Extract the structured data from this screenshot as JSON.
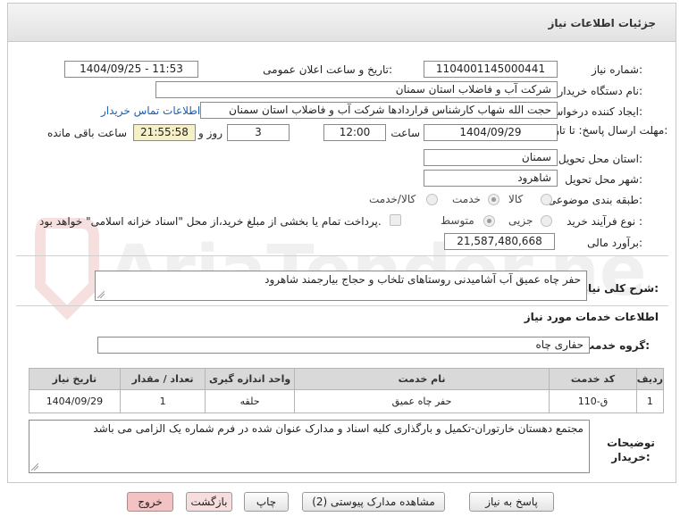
{
  "header": {
    "title": "جزئیات اطلاعات نیاز"
  },
  "fields": {
    "need_number_label": "شماره نیاز:",
    "need_number": "1104001145000441",
    "announce_label": "تاریخ و ساعت اعلان عمومی:",
    "announce_value": "1404/09/25 - 11:53",
    "buyer_org_label": "نام دستگاه خریدار:",
    "buyer_org": "شرکت آب و فاضلاب استان سمنان",
    "creator_label": "ایجاد کننده درخواست:",
    "creator": "حجت الله شهاب کارشناس قراردادها شرکت آب و فاضلاب استان سمنان",
    "contact_link": "اطلاعات تماس خریدار",
    "deadline_label": "مهلت ارسال پاسخ: تا تاریخ:",
    "deadline_date": "1404/09/29",
    "time_label": "ساعت",
    "deadline_time": "12:00",
    "days_value": "3",
    "days_label": "روز و",
    "remaining_time": "21:55:58",
    "remaining_label": "ساعت باقی مانده",
    "province_label": "استان محل تحویل:",
    "province": "سمنان",
    "city_label": "شهر محل تحویل:",
    "city": "شاهرود",
    "category_label": "طبقه بندی موضوعی:",
    "category_options": [
      "کالا",
      "خدمت",
      "کالا/خدمت"
    ],
    "category_selected": "خدمت",
    "process_label": "نوع فرآیند خرید :",
    "process_options": [
      "جزیی",
      "متوسط"
    ],
    "process_selected": "متوسط",
    "payment_note": "پرداخت تمام یا بخشی از مبلغ خرید،از محل \"اسناد خزانه اسلامی\" خواهد بود.",
    "estimate_label": "برآورد مالی:",
    "estimate": "21,587,480,668"
  },
  "description": {
    "label": "شرح کلی نیاز:",
    "text": "حفر چاه عمیق آب آشامیدنی روستاهای تلخاب و حجاج بیارجمند شاهرود"
  },
  "services": {
    "section_title": "اطلاعات خدمات مورد نیاز",
    "group_label": "گروه خدمت:",
    "group_value": "حفاری چاه",
    "columns": [
      "ردیف",
      "کد خدمت",
      "نام خدمت",
      "واحد اندازه گیری",
      "تعداد / مقدار",
      "تاریخ نیاز"
    ],
    "rows": [
      [
        "1",
        "ق-110",
        "حفر چاه عمیق",
        "حلقه",
        "1",
        "1404/09/29"
      ]
    ]
  },
  "notes": {
    "label": "توضیحات خریدار:",
    "text": "مجتمع دهستان خارتوران-تکمیل و بارگذاری کلیه اسناد و مدارک عنوان شده در فرم شماره یک الزامی می باشد"
  },
  "buttons": {
    "reply": "پاسخ به نیاز",
    "attachments": "مشاهده مدارک پیوستی (2)",
    "print": "چاپ",
    "back": "بازگشت",
    "exit": "خروج"
  },
  "watermark": "AriaTender.neT"
}
